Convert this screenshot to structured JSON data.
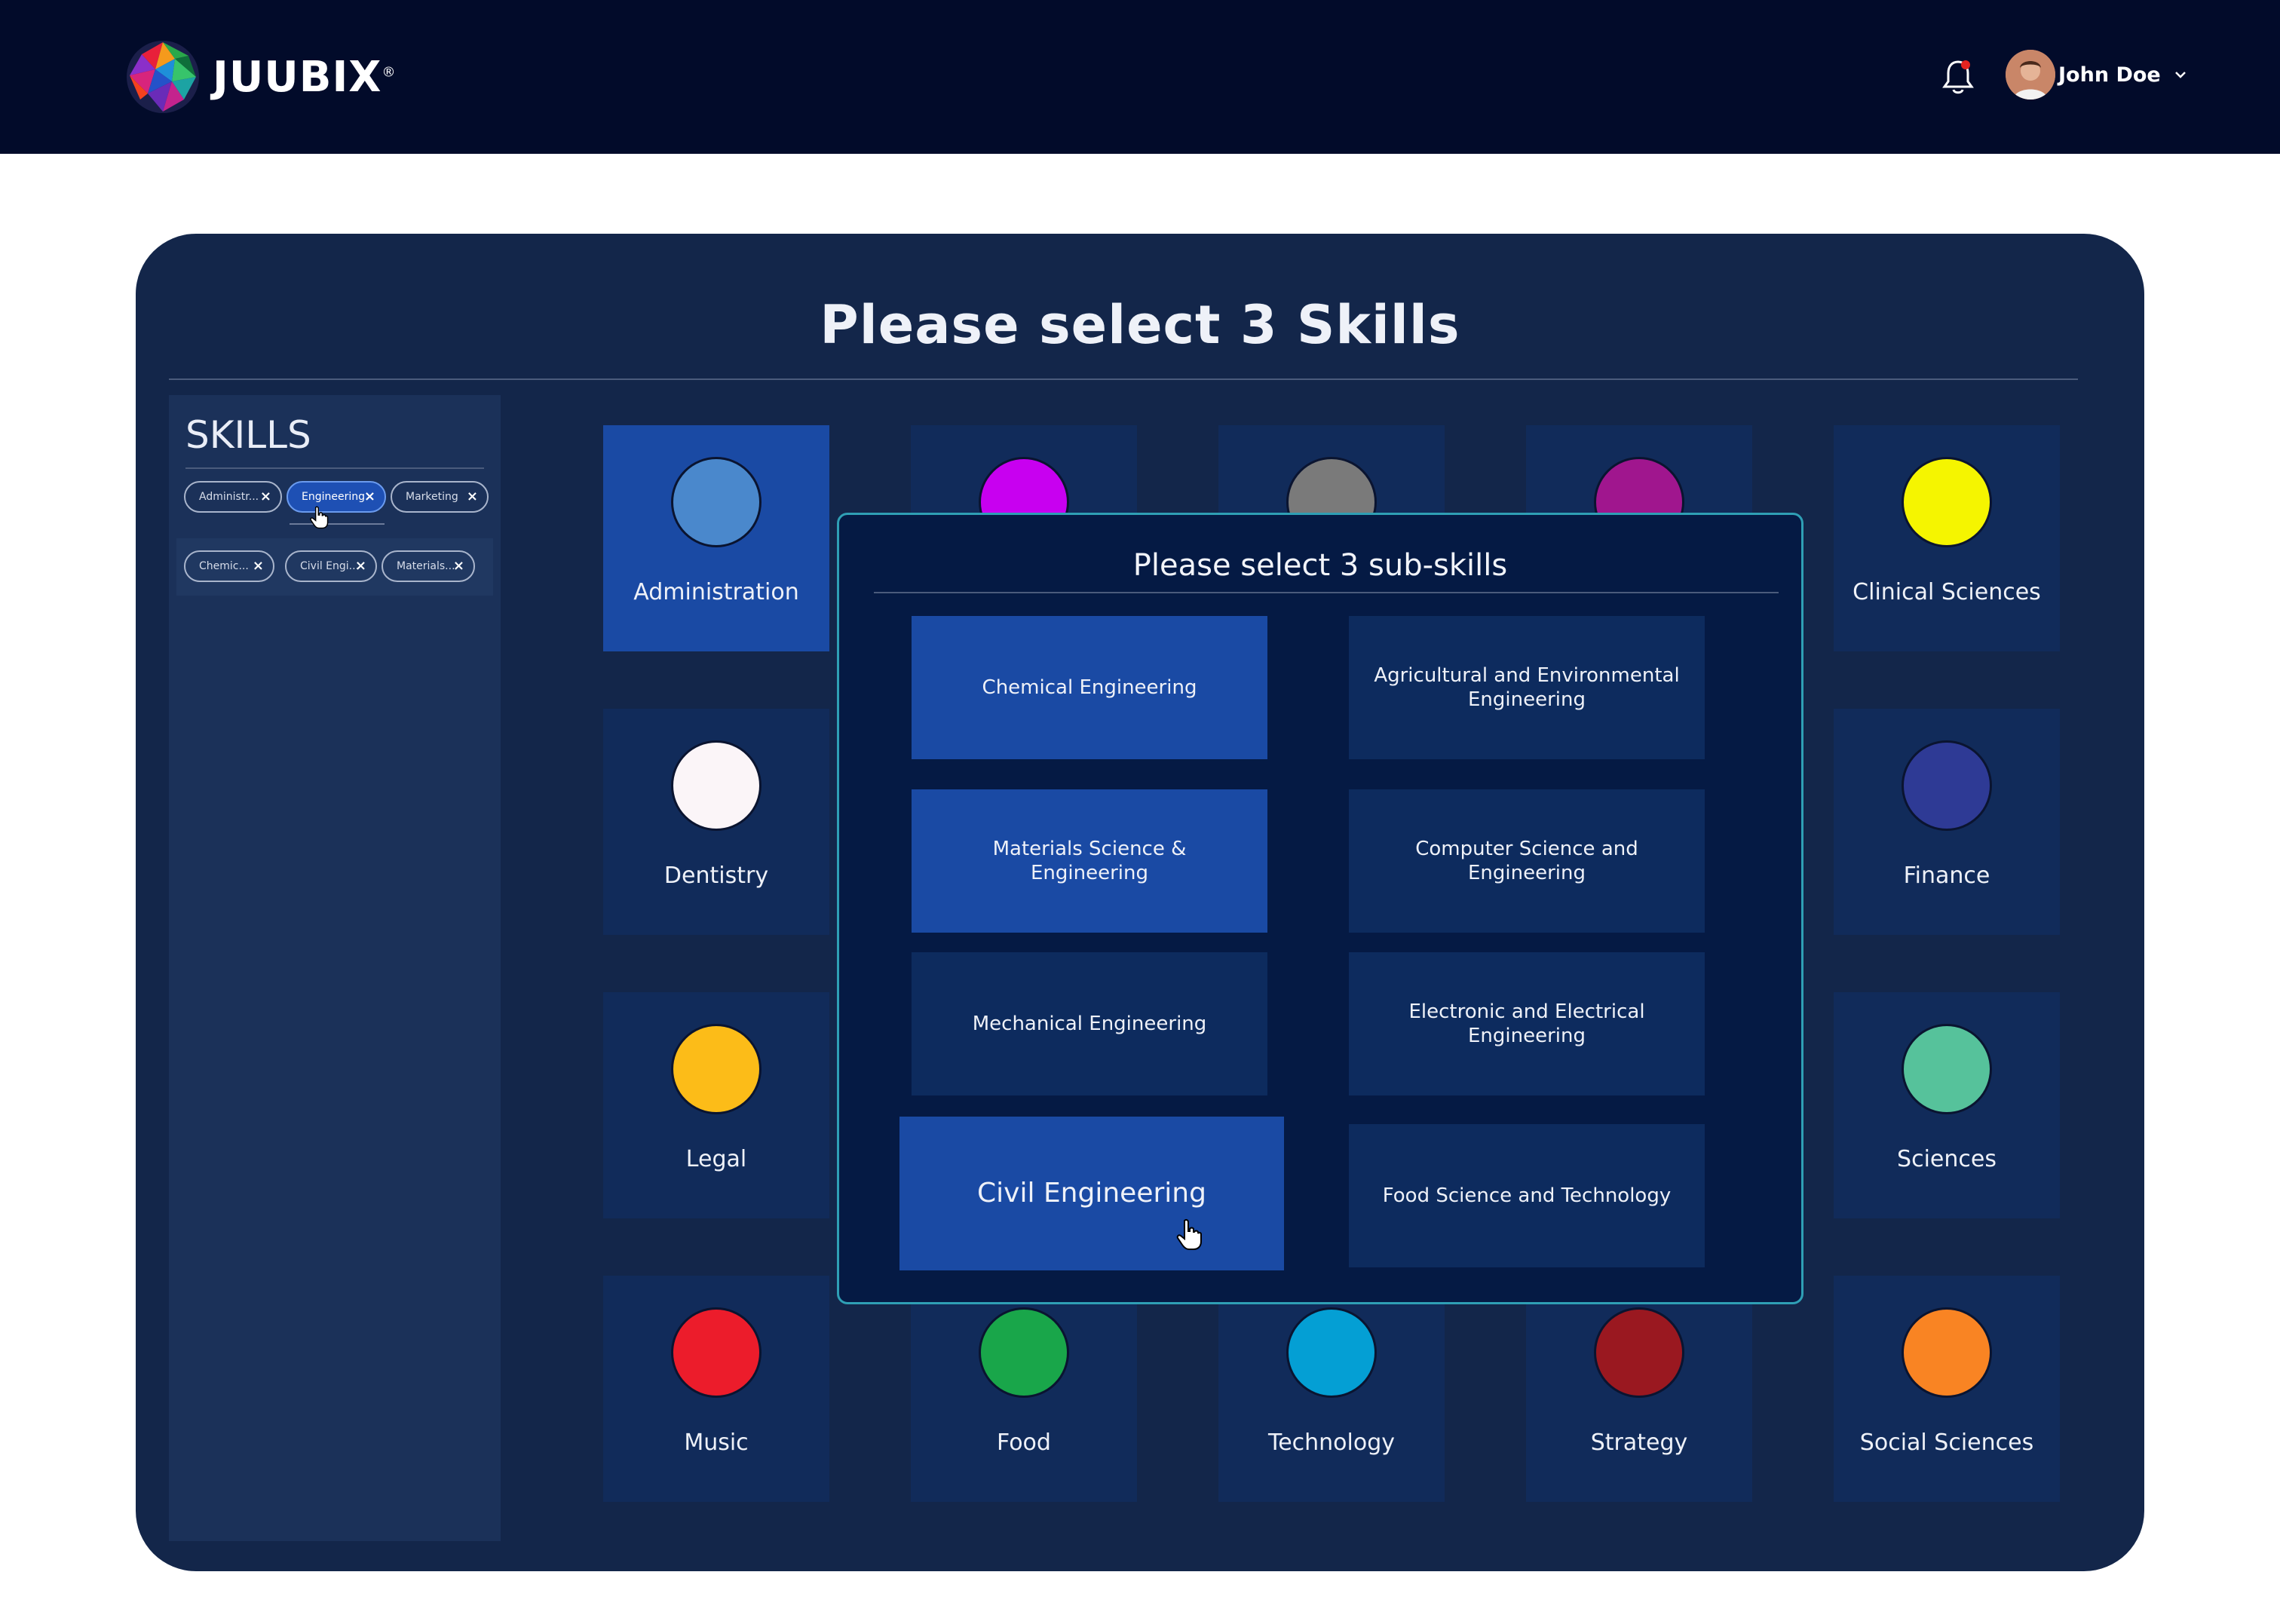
{
  "header": {
    "brand": "JUUBIX",
    "brand_mark": "®",
    "user_name": "John Doe",
    "icons": [
      "juubix-logo-icon",
      "bell-icon",
      "avatar",
      "chevron-down-icon"
    ],
    "notification_dot_color": "#e32420"
  },
  "main": {
    "title": "Please select 3 Skills"
  },
  "sidebar": {
    "title": "SKILLS",
    "skill_chips": [
      {
        "label": "Administr..."
      },
      {
        "label": "Engineering"
      },
      {
        "label": "Marketing"
      }
    ],
    "subskill_chips": [
      {
        "label": "Chemic..."
      },
      {
        "label": "Civil Engi..."
      },
      {
        "label": "Materials..."
      }
    ],
    "remove_glyph": "×"
  },
  "skills": [
    {
      "label": "Administration",
      "color": "#4a88cc"
    },
    {
      "label": "",
      "color": "#c800f0"
    },
    {
      "label": "",
      "color": "#7a7a7a"
    },
    {
      "label": "",
      "color": "#a0168e"
    },
    {
      "label": "Clinical Sciences",
      "color": "#f5f500"
    },
    {
      "label": "Dentistry",
      "color": "#fbf5f8"
    },
    {
      "label": "Finance",
      "color": "#2e3a95"
    },
    {
      "label": "Legal",
      "color": "#fcbc18"
    },
    {
      "label": "Sciences",
      "color": "#56c29b"
    },
    {
      "label": "Music",
      "color": "#ec1c2b"
    },
    {
      "label": "Food",
      "color": "#19a64a"
    },
    {
      "label": "Technology",
      "color": "#049fd4"
    },
    {
      "label": "Strategy",
      "color": "#9a1820"
    },
    {
      "label": "Social Sciences",
      "color": "#f98423"
    }
  ],
  "modal": {
    "title": "Please select 3 sub-skills",
    "subskills": [
      {
        "label": "Chemical Engineering"
      },
      {
        "label": "Agricultural and Environmental Engineering"
      },
      {
        "label": "Materials Science & Engineering"
      },
      {
        "label": "Computer Science and Engineering"
      },
      {
        "label": "Mechanical Engineering"
      },
      {
        "label": "Electronic and Electrical Engineering"
      },
      {
        "label": "Civil Engineering"
      },
      {
        "label": "Food Science and Technology"
      }
    ]
  }
}
